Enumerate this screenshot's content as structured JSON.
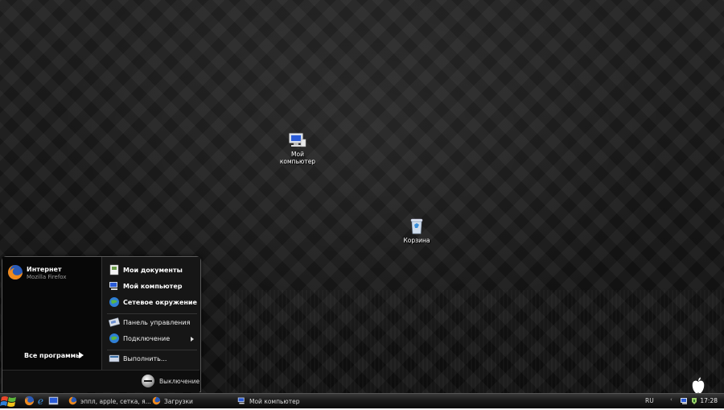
{
  "desktop": {
    "icons": [
      {
        "label_line1": "Мой",
        "label_line2": "компьютер",
        "icon": "my-computer-icon"
      },
      {
        "label_line1": "Корзина",
        "label_line2": "",
        "icon": "recycle-bin-icon"
      }
    ]
  },
  "start_menu": {
    "pinned": {
      "name": "Интернет",
      "subtitle": "Mozilla Firefox",
      "icon": "firefox-icon"
    },
    "all_programs_label": "Все программы",
    "right_items": [
      {
        "label": "Мои документы",
        "icon": "my-documents-icon",
        "bold": true
      },
      {
        "label": "Мой компьютер",
        "icon": "my-computer-icon",
        "bold": true
      },
      {
        "label": "Сетевое окружение",
        "icon": "network-places-icon",
        "bold": true
      },
      {
        "label": "Панель управления",
        "icon": "control-panel-icon",
        "bold": false
      },
      {
        "label": "Подключение",
        "icon": "connect-to-icon",
        "bold": false
      },
      {
        "label": "Выполнить...",
        "icon": "run-icon",
        "bold": false
      }
    ],
    "shutdown_label": "Выключение"
  },
  "taskbar": {
    "quick_launch": [
      {
        "icon": "firefox-icon"
      },
      {
        "icon": "internet-explorer-icon"
      },
      {
        "icon": "show-desktop-icon"
      }
    ],
    "tasks": [
      {
        "label": "эппл, apple, сетка, я...",
        "icon": "firefox-icon"
      },
      {
        "label": "Загрузки",
        "icon": "firefox-icon"
      },
      {
        "label": "Мой компьютер",
        "icon": "my-computer-icon"
      }
    ],
    "language": "RU",
    "tray_chevron": "‹",
    "clock": "17:28"
  },
  "colors": {
    "accent": "#3a6ea5",
    "menu_bg": "#0b0b0b",
    "taskbar_bg": "#1a1a1a"
  }
}
